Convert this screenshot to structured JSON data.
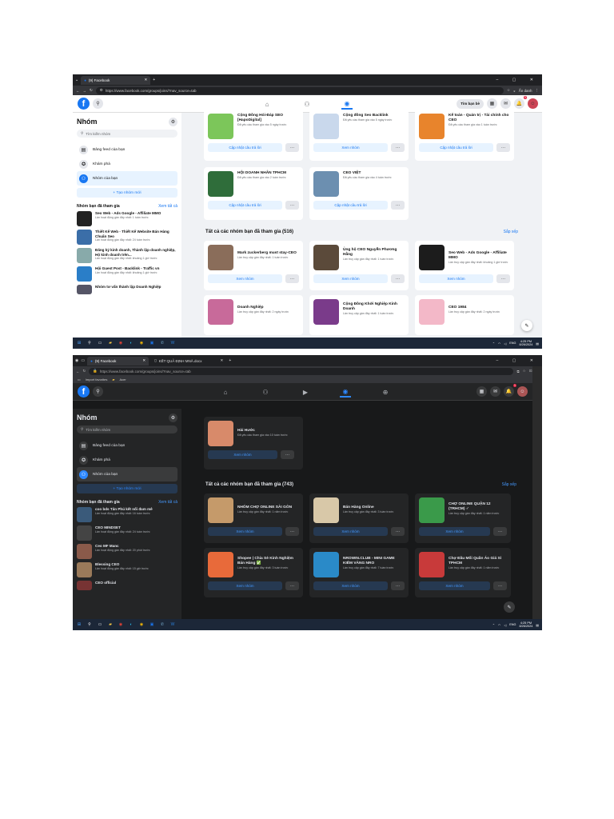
{
  "shot1": {
    "browser_tab": "(9) Facebook",
    "url": "https://www.facebook.com/groups/joins/?nav_source=tab",
    "find_friends": "Tìm bạn bè",
    "notif_count": "9",
    "profile_label": "Ẩn danh",
    "sidebar": {
      "title": "Nhóm",
      "search_placeholder": "Tìm kiếm nhóm",
      "nav": [
        "Bảng feed của bạn",
        "Khám phá",
        "Nhóm của bạn"
      ],
      "create_group": "+ Tạo nhóm mới",
      "joined_title": "Nhóm bạn đã tham gia",
      "see_all": "Xem tất cả",
      "groups": [
        {
          "name": "Seo Web - Ads Google - Affiliate MMO",
          "sub": "Lần hoạt động gần đây nhất: 1 tuần trước"
        },
        {
          "name": "Thiết Kế Web - Thiết Kế Website Bán Hàng Chuẩn Seo",
          "sub": "Lần hoạt động gần đây nhất: 24 tuần trước"
        },
        {
          "name": "Đăng ký kinh doanh, Thành lập doanh nghiệp, Hộ kinh doanh trên...",
          "sub": "Lần hoạt động gần đây nhất: khoảng 1 giờ trước"
        },
        {
          "name": "Hội Guest Post - Backlink - Traffic vn",
          "sub": "Lần hoạt động gần đây nhất: khoảng 1 giờ trước"
        },
        {
          "name": "Nhóm tư vấn thành lập Doanh Nghiệp",
          "sub": ""
        }
      ]
    },
    "top_cards": [
      {
        "name": "Cộng Đồng Hỏi-Đáp SEO [HapoDigital]",
        "sub": "Đã yêu cầu tham gia vào 5 ngày trước",
        "btn": "Cập nhật câu trả lời"
      },
      {
        "name": "Cộng đồng Seo Backlink",
        "sub": "Đã yêu cầu tham gia vào 5 ngày trước",
        "btn": "Xem nhóm"
      },
      {
        "name": "Kế toán - Quản trị - Tài chính cho CEO",
        "sub": "Đã yêu cầu tham gia vào 1 tuần trước",
        "btn": "Cập nhật câu trả lời"
      },
      {
        "name": "HỘI DOANH NHÂN TPHCM",
        "sub": "Đã yêu cầu tham gia vào 2 tuần trước",
        "btn": "Cập nhật câu trả lời"
      },
      {
        "name": "CEO VIỆT",
        "sub": "Đã yêu cầu tham gia vào 4 tuần trước",
        "btn": "Cập nhật câu trả lời"
      }
    ],
    "all_title": "Tất cả các nhóm bạn đã tham gia (516)",
    "sort": "Sắp xếp",
    "all_cards": [
      {
        "name": "Mark zuckerberg must stay-CEO",
        "sub": "Lần truy cập gần đây nhất: 1 tuần trước",
        "btn": "Xem nhóm"
      },
      {
        "name": "Ủng hộ CEO Nguyễn Phương Hằng",
        "sub": "Lần truy cập gần đây nhất: 1 tuần trước",
        "btn": "Xem nhóm"
      },
      {
        "name": "Seo Web - Ads Google - Affiliate MMO",
        "sub": "Lần truy cập gần đây nhất: khoảng 1 giờ trước",
        "btn": "Xem nhóm"
      },
      {
        "name": "Doanh Nghiệp",
        "sub": "Lần truy cập gần đây nhất: 2 ngày trước",
        "btn": ""
      },
      {
        "name": "Cộng Đồng Khởi Nghiệp Kinh Doanh",
        "sub": "Lần truy cập gần đây nhất: 1 tuần trước",
        "btn": ""
      },
      {
        "name": "CEO 1984",
        "sub": "Lần truy cập gần đây nhất: 2 ngày trước",
        "btn": ""
      }
    ],
    "more": "···",
    "clock": "4:25 PM",
    "date": "8/26/2024",
    "lang": "ENG"
  },
  "shot2": {
    "browser_tab": "(9) Facebook",
    "browser_tab2": "KẾT QUẢ ĐỊNH MNĂ.docx",
    "url": "https://www.facebook.com/groups/joins/?nav_source=tab",
    "bookmarks": [
      "Import favorites",
      "Acer"
    ],
    "notif_count": "1",
    "sidebar": {
      "title": "Nhóm",
      "search_placeholder": "Tìm kiếm nhóm",
      "nav": [
        "Bảng feed của bạn",
        "Khám phá",
        "Nhóm của bạn"
      ],
      "create_group": "+ Tạo nhóm mới",
      "joined_title": "Nhóm bạn đã tham gia",
      "see_all": "Xem tất cả",
      "groups": [
        {
          "name": "coo bds Tân Phú kết nối đam mê",
          "sub": "Lần hoạt động gần đây nhất: 16 tuần trước"
        },
        {
          "name": "CEO MINDSET",
          "sub": "Lần hoạt động gần đây nhất: 24 tuần trước"
        },
        {
          "name": "Ceo MF Manc",
          "sub": "Lần hoạt động gần đây nhất: 20 phút trước"
        },
        {
          "name": "Blessing CEO",
          "sub": "Lần hoạt động gần đây nhất: 15 giờ trước"
        },
        {
          "name": "CEO official",
          "sub": ""
        }
      ]
    },
    "top_card": {
      "name": "Hài Hước",
      "sub": "Đã yêu cầu tham gia vào 10 tuần trước",
      "btn": "Xem nhóm"
    },
    "all_title": "Tất cả các nhóm bạn đã tham gia (743)",
    "sort": "Sắp xếp",
    "all_cards": [
      {
        "name": "NHÓM CHỢ ONLINE SÀI GÒN",
        "sub": "Lần truy cập gần đây nhất: 1 năm trước",
        "btn": "Xem nhóm"
      },
      {
        "name": "Bán Hàng Online",
        "sub": "Lần truy cập gần đây nhất: 3 tuần trước",
        "btn": "Xem nhóm"
      },
      {
        "name": "CHỢ ONLINE QUẬN 12 (TRHCM) ✓",
        "sub": "Lần truy cập gần đây nhất: 1 năm trước",
        "btn": "Xem nhóm"
      },
      {
        "name": "Shopee | Chia Sẻ Kinh Nghiệm Bán Hàng ✅",
        "sub": "Lần truy cập gần đây nhất: 3 tuần trước",
        "btn": "Xem nhóm"
      },
      {
        "name": "NROWIN.CLUB - MINI GAME KIẾM VÀNG NRO",
        "sub": "Lần truy cập gần đây nhất: 7 tuần trước",
        "btn": "Xem nhóm"
      },
      {
        "name": "Chợ Đầu Mối Quần Áo Giá Sỉ TPHCM",
        "sub": "Lần truy cập gần đây nhất: 1 năm trước",
        "btn": "Xem nhóm"
      }
    ],
    "more": "···",
    "clock": "4:25 PM",
    "date": "8/26/2024",
    "lang": "ENG"
  }
}
